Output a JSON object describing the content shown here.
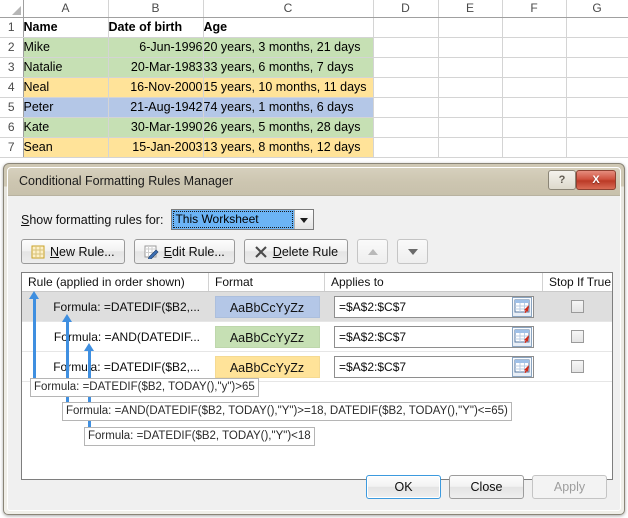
{
  "sheet": {
    "columns": [
      "A",
      "B",
      "C",
      "D",
      "E",
      "F",
      "G"
    ],
    "rows": [
      "1",
      "2",
      "3",
      "4",
      "5",
      "6",
      "7"
    ],
    "header": {
      "a": "Name",
      "b": "Date of birth",
      "c": "Age"
    },
    "data": [
      {
        "row": "2",
        "name": "Mike",
        "dob": "6-Jun-1996",
        "age": "20 years, 3 months, 21 days",
        "fill": "#c6e0b4"
      },
      {
        "row": "3",
        "name": "Natalie",
        "dob": "20-Mar-1983",
        "age": "33 years, 6 months, 7 days",
        "fill": "#c6e0b4"
      },
      {
        "row": "4",
        "name": "Neal",
        "dob": "16-Nov-2000",
        "age": "15 years, 10 months, 11 days",
        "fill": "#ffe399"
      },
      {
        "row": "5",
        "name": "Peter",
        "dob": "21-Aug-1942",
        "age": "74 years, 1 months, 6 days",
        "fill": "#b4c7e7"
      },
      {
        "row": "6",
        "name": "Kate",
        "dob": "30-Mar-1990",
        "age": "26 years, 5 months, 28 days",
        "fill": "#c6e0b4"
      },
      {
        "row": "7",
        "name": "Sean",
        "dob": "15-Jan-2003",
        "age": "13 years, 8 months, 12 days",
        "fill": "#ffe399"
      }
    ]
  },
  "dialog": {
    "title": "Conditional Formatting Rules Manager",
    "help_label": "?",
    "close_label": "X",
    "show_label_u": "S",
    "show_label_rest": "how formatting rules for:",
    "scope_value": "This Worksheet",
    "toolbar": {
      "new_rule_u": "N",
      "new_rule_rest": "ew Rule...",
      "edit_rule_u": "E",
      "edit_rule_rest": "dit Rule...",
      "delete_rule_u": "D",
      "delete_rule_rest": "elete Rule"
    },
    "columns": {
      "rule": "Rule (applied in order shown)",
      "format": "Format",
      "applies_to": "Applies to",
      "stop_if_true": "Stop If True"
    },
    "rules": [
      {
        "name": "Formula: =DATEDIF($B2,...",
        "preview": "AaBbCcYyZz",
        "preview_bg": "#b4c7e7",
        "applies_to": "=$A$2:$C$7",
        "selected": true
      },
      {
        "name": "Formula: =AND(DATEDIF...",
        "preview": "AaBbCcYyZz",
        "preview_bg": "#c6e0b4",
        "applies_to": "=$A$2:$C$7",
        "selected": false
      },
      {
        "name": "Formula: =DATEDIF($B2,...",
        "preview": "AaBbCcYyZz",
        "preview_bg": "#ffe399",
        "applies_to": "=$A$2:$C$7",
        "selected": false
      }
    ],
    "callouts": [
      "Formula: =DATEDIF($B2, TODAY(),\"y\")>65",
      "Formula: =AND(DATEDIF($B2, TODAY(),\"Y\")>=18, DATEDIF($B2, TODAY(),\"Y\")<=65)",
      "Formula: =DATEDIF($B2, TODAY(),\"Y\")<18"
    ],
    "buttons": {
      "ok": "OK",
      "close": "Close",
      "apply": "Apply"
    }
  }
}
